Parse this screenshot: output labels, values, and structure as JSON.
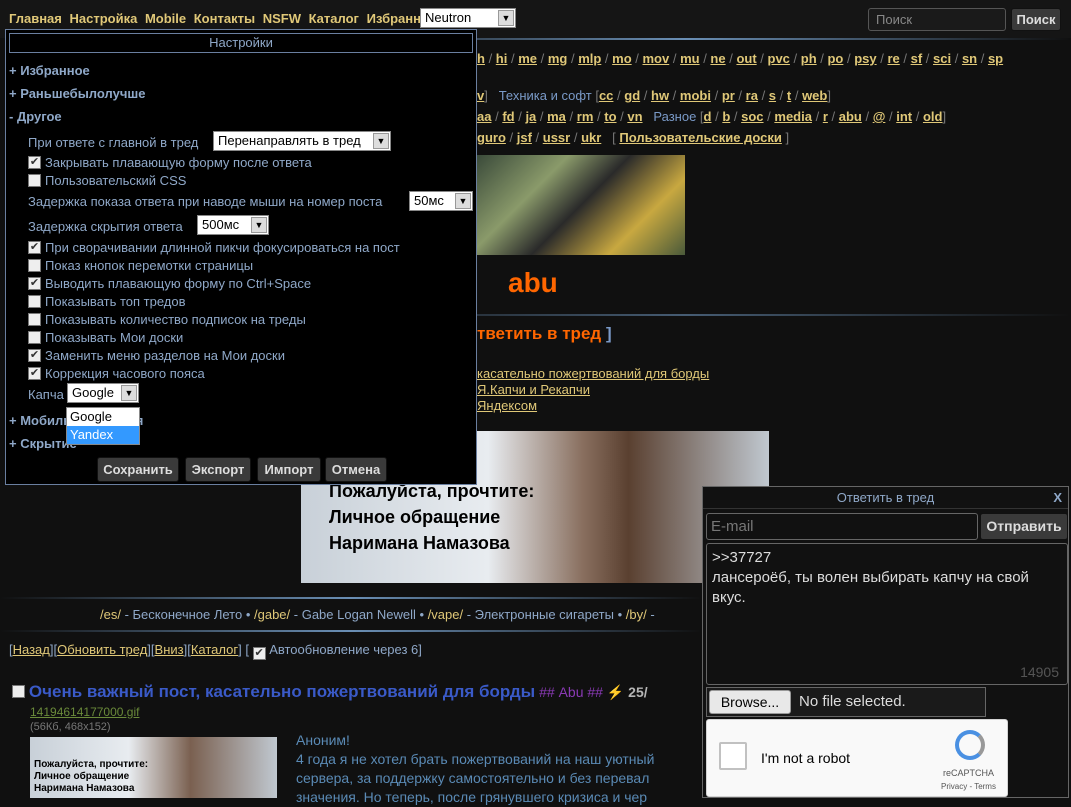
{
  "nav": {
    "links": [
      "Главная",
      "Настройка",
      "Mobile",
      "Контакты",
      "NSFW",
      "Каталог",
      "Избранное"
    ],
    "style_select": "Neutron",
    "search_placeholder": "Поиск",
    "search_button": "Поиск"
  },
  "boards": {
    "row1": [
      "h",
      "hi",
      "me",
      "mg",
      "mlp",
      "mo",
      "mov",
      "mu",
      "ne",
      "out",
      "pvc",
      "ph",
      "po",
      "psy",
      "re",
      "sf",
      "sci",
      "sn",
      "sp"
    ],
    "row2_tail": "v",
    "tech_label": "Техника и софт",
    "tech": [
      "cc",
      "gd",
      "hw",
      "mobi",
      "pr",
      "ra",
      "s",
      "t",
      "web"
    ],
    "row3": [
      "aa",
      "fd",
      "ja",
      "ma",
      "rm",
      "to",
      "vn"
    ],
    "misc_label": "Разное",
    "misc": [
      "d",
      "b",
      "soc",
      "media",
      "r",
      "abu",
      "@",
      "int",
      "old"
    ],
    "row4": [
      "guro",
      "jsf",
      "ussr",
      "ukr"
    ],
    "user_boards": "Пользовательские доски"
  },
  "board_title": "abu",
  "reply_link": "тветить в тред",
  "notices": [
    "касательно пожертвований для борды",
    "Я.Капчи и Рекапчи",
    "Яндексом"
  ],
  "banner": {
    "line1": "Пожалуйста, прочтите:",
    "line2": "Личное обращение",
    "line3": "Наримана Намазова"
  },
  "ticker": [
    {
      "b": "/es/",
      "t": "- Бесконечное Лето"
    },
    {
      "b": "/gabe/",
      "t": "- Gabe Logan Newell"
    },
    {
      "b": "/vape/",
      "t": "- Электронные сигареты"
    },
    {
      "b": "/by/",
      "t": "- "
    }
  ],
  "thread_nav": {
    "back": "Назад",
    "refresh": "Обновить тред",
    "down": "Вниз",
    "catalog": "Каталог",
    "auto": "Автообновление через 6"
  },
  "post": {
    "subject": "Очень важный пост, касательно пожертвований для борды",
    "trip": "## Abu ##",
    "date": "25/",
    "file": "14194614177000.gif",
    "fileinfo": "(56Кб, 468x152)",
    "author": "Аноним!",
    "lines": [
      "4 года я не хотел брать пожертвований на наш уютный",
      "сервера, за поддержку самостоятельно и без перевал",
      "значения. Но теперь, после грянувшего кризиса и чер"
    ],
    "thumb": [
      "Пожалуйста, прочтите:",
      "Личное обращение",
      "Наримана Намазова"
    ]
  },
  "settings": {
    "title": "Настройки",
    "sections": [
      "+ Избранное",
      "+ Раньшебылолучше",
      "- Другое",
      "+ Мобильная версия",
      "+ Скрытие"
    ],
    "reply_mode_label": "При ответе с главной в тред",
    "reply_mode_value": "Перенаправлять в тред",
    "checks": [
      {
        "label": "Закрывать плавающую форму после ответа",
        "on": true
      },
      {
        "label": "Пользовательский CSS",
        "on": false
      }
    ],
    "delay_show_label": "Задержка показа ответа при наводе мыши на номер поста",
    "delay_show_value": "50мс",
    "delay_hide_label": "Задержка скрытия ответа",
    "delay_hide_value": "500мс",
    "checks2": [
      {
        "label": "При сворачивании длинной пикчи фокусироваться на пост",
        "on": true
      },
      {
        "label": "Показ кнопок перемотки страницы",
        "on": false
      },
      {
        "label": "Выводить плавающую форму по Ctrl+Space",
        "on": true
      },
      {
        "label": "Показывать топ тредов",
        "on": false
      },
      {
        "label": "Показывать количество подписок на треды",
        "on": false
      },
      {
        "label": "Показывать Мои доски",
        "on": false
      },
      {
        "label": "Заменить меню разделов на Мои доски",
        "on": true
      },
      {
        "label": "Коррекция часового пояса",
        "on": true
      }
    ],
    "captcha_label": "Капча",
    "captcha_value": "Google",
    "captcha_options": [
      "Google",
      "Yandex"
    ],
    "buttons": [
      "Сохранить",
      "Экспорт",
      "Импорт",
      "Отмена"
    ]
  },
  "reply": {
    "title": "Ответить в тред",
    "close": "X",
    "email_placeholder": "E-mail",
    "send": "Отправить",
    "text_lines": [
      ">>37727",
      "лансероёб, ты волен выбирать капчу на свой",
      "вкус."
    ],
    "counter": "14905",
    "browse": "Browse...",
    "no_file": "No file selected.",
    "robot": "I'm not a robot",
    "recaptcha": "reCAPTCHA",
    "privacy": "Privacy - Terms"
  }
}
